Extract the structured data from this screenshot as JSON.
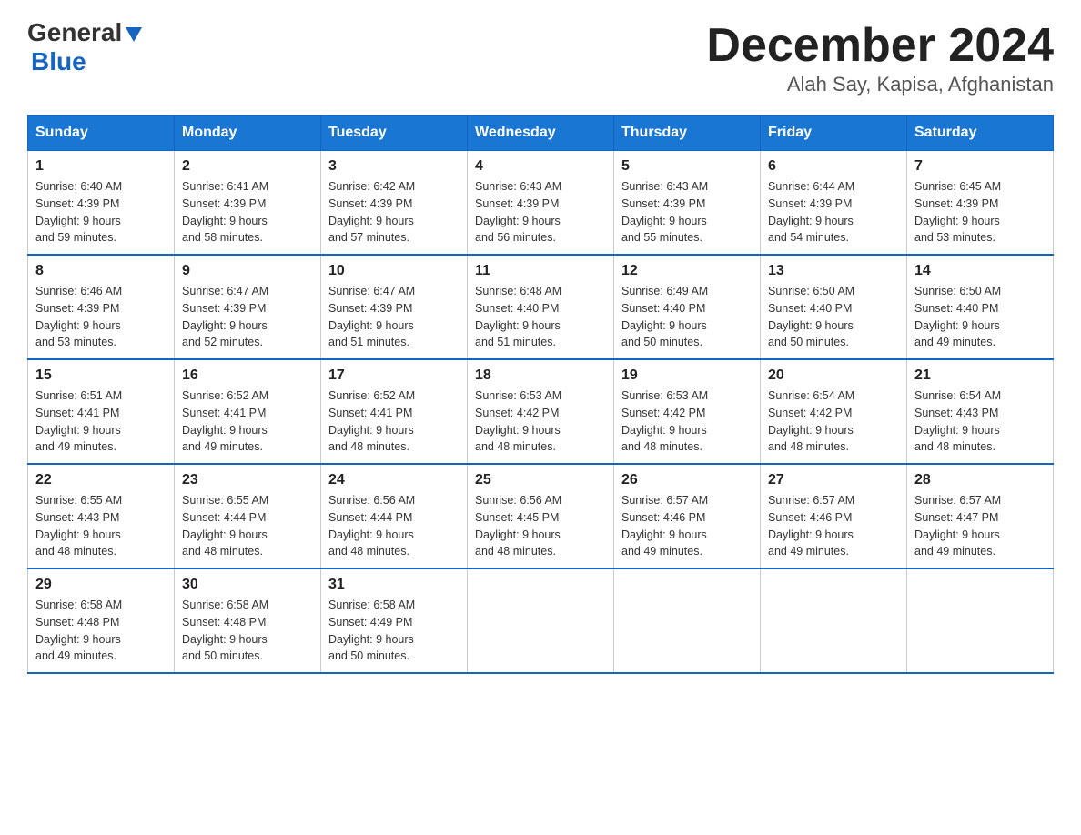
{
  "header": {
    "logo_general": "General",
    "logo_blue": "Blue",
    "title": "December 2024",
    "subtitle": "Alah Say, Kapisa, Afghanistan"
  },
  "weekdays": [
    "Sunday",
    "Monday",
    "Tuesday",
    "Wednesday",
    "Thursday",
    "Friday",
    "Saturday"
  ],
  "weeks": [
    [
      {
        "day": "1",
        "sunrise": "Sunrise: 6:40 AM",
        "sunset": "Sunset: 4:39 PM",
        "daylight": "Daylight: 9 hours",
        "daylight2": "and 59 minutes."
      },
      {
        "day": "2",
        "sunrise": "Sunrise: 6:41 AM",
        "sunset": "Sunset: 4:39 PM",
        "daylight": "Daylight: 9 hours",
        "daylight2": "and 58 minutes."
      },
      {
        "day": "3",
        "sunrise": "Sunrise: 6:42 AM",
        "sunset": "Sunset: 4:39 PM",
        "daylight": "Daylight: 9 hours",
        "daylight2": "and 57 minutes."
      },
      {
        "day": "4",
        "sunrise": "Sunrise: 6:43 AM",
        "sunset": "Sunset: 4:39 PM",
        "daylight": "Daylight: 9 hours",
        "daylight2": "and 56 minutes."
      },
      {
        "day": "5",
        "sunrise": "Sunrise: 6:43 AM",
        "sunset": "Sunset: 4:39 PM",
        "daylight": "Daylight: 9 hours",
        "daylight2": "and 55 minutes."
      },
      {
        "day": "6",
        "sunrise": "Sunrise: 6:44 AM",
        "sunset": "Sunset: 4:39 PM",
        "daylight": "Daylight: 9 hours",
        "daylight2": "and 54 minutes."
      },
      {
        "day": "7",
        "sunrise": "Sunrise: 6:45 AM",
        "sunset": "Sunset: 4:39 PM",
        "daylight": "Daylight: 9 hours",
        "daylight2": "and 53 minutes."
      }
    ],
    [
      {
        "day": "8",
        "sunrise": "Sunrise: 6:46 AM",
        "sunset": "Sunset: 4:39 PM",
        "daylight": "Daylight: 9 hours",
        "daylight2": "and 53 minutes."
      },
      {
        "day": "9",
        "sunrise": "Sunrise: 6:47 AM",
        "sunset": "Sunset: 4:39 PM",
        "daylight": "Daylight: 9 hours",
        "daylight2": "and 52 minutes."
      },
      {
        "day": "10",
        "sunrise": "Sunrise: 6:47 AM",
        "sunset": "Sunset: 4:39 PM",
        "daylight": "Daylight: 9 hours",
        "daylight2": "and 51 minutes."
      },
      {
        "day": "11",
        "sunrise": "Sunrise: 6:48 AM",
        "sunset": "Sunset: 4:40 PM",
        "daylight": "Daylight: 9 hours",
        "daylight2": "and 51 minutes."
      },
      {
        "day": "12",
        "sunrise": "Sunrise: 6:49 AM",
        "sunset": "Sunset: 4:40 PM",
        "daylight": "Daylight: 9 hours",
        "daylight2": "and 50 minutes."
      },
      {
        "day": "13",
        "sunrise": "Sunrise: 6:50 AM",
        "sunset": "Sunset: 4:40 PM",
        "daylight": "Daylight: 9 hours",
        "daylight2": "and 50 minutes."
      },
      {
        "day": "14",
        "sunrise": "Sunrise: 6:50 AM",
        "sunset": "Sunset: 4:40 PM",
        "daylight": "Daylight: 9 hours",
        "daylight2": "and 49 minutes."
      }
    ],
    [
      {
        "day": "15",
        "sunrise": "Sunrise: 6:51 AM",
        "sunset": "Sunset: 4:41 PM",
        "daylight": "Daylight: 9 hours",
        "daylight2": "and 49 minutes."
      },
      {
        "day": "16",
        "sunrise": "Sunrise: 6:52 AM",
        "sunset": "Sunset: 4:41 PM",
        "daylight": "Daylight: 9 hours",
        "daylight2": "and 49 minutes."
      },
      {
        "day": "17",
        "sunrise": "Sunrise: 6:52 AM",
        "sunset": "Sunset: 4:41 PM",
        "daylight": "Daylight: 9 hours",
        "daylight2": "and 48 minutes."
      },
      {
        "day": "18",
        "sunrise": "Sunrise: 6:53 AM",
        "sunset": "Sunset: 4:42 PM",
        "daylight": "Daylight: 9 hours",
        "daylight2": "and 48 minutes."
      },
      {
        "day": "19",
        "sunrise": "Sunrise: 6:53 AM",
        "sunset": "Sunset: 4:42 PM",
        "daylight": "Daylight: 9 hours",
        "daylight2": "and 48 minutes."
      },
      {
        "day": "20",
        "sunrise": "Sunrise: 6:54 AM",
        "sunset": "Sunset: 4:42 PM",
        "daylight": "Daylight: 9 hours",
        "daylight2": "and 48 minutes."
      },
      {
        "day": "21",
        "sunrise": "Sunrise: 6:54 AM",
        "sunset": "Sunset: 4:43 PM",
        "daylight": "Daylight: 9 hours",
        "daylight2": "and 48 minutes."
      }
    ],
    [
      {
        "day": "22",
        "sunrise": "Sunrise: 6:55 AM",
        "sunset": "Sunset: 4:43 PM",
        "daylight": "Daylight: 9 hours",
        "daylight2": "and 48 minutes."
      },
      {
        "day": "23",
        "sunrise": "Sunrise: 6:55 AM",
        "sunset": "Sunset: 4:44 PM",
        "daylight": "Daylight: 9 hours",
        "daylight2": "and 48 minutes."
      },
      {
        "day": "24",
        "sunrise": "Sunrise: 6:56 AM",
        "sunset": "Sunset: 4:44 PM",
        "daylight": "Daylight: 9 hours",
        "daylight2": "and 48 minutes."
      },
      {
        "day": "25",
        "sunrise": "Sunrise: 6:56 AM",
        "sunset": "Sunset: 4:45 PM",
        "daylight": "Daylight: 9 hours",
        "daylight2": "and 48 minutes."
      },
      {
        "day": "26",
        "sunrise": "Sunrise: 6:57 AM",
        "sunset": "Sunset: 4:46 PM",
        "daylight": "Daylight: 9 hours",
        "daylight2": "and 49 minutes."
      },
      {
        "day": "27",
        "sunrise": "Sunrise: 6:57 AM",
        "sunset": "Sunset: 4:46 PM",
        "daylight": "Daylight: 9 hours",
        "daylight2": "and 49 minutes."
      },
      {
        "day": "28",
        "sunrise": "Sunrise: 6:57 AM",
        "sunset": "Sunset: 4:47 PM",
        "daylight": "Daylight: 9 hours",
        "daylight2": "and 49 minutes."
      }
    ],
    [
      {
        "day": "29",
        "sunrise": "Sunrise: 6:58 AM",
        "sunset": "Sunset: 4:48 PM",
        "daylight": "Daylight: 9 hours",
        "daylight2": "and 49 minutes."
      },
      {
        "day": "30",
        "sunrise": "Sunrise: 6:58 AM",
        "sunset": "Sunset: 4:48 PM",
        "daylight": "Daylight: 9 hours",
        "daylight2": "and 50 minutes."
      },
      {
        "day": "31",
        "sunrise": "Sunrise: 6:58 AM",
        "sunset": "Sunset: 4:49 PM",
        "daylight": "Daylight: 9 hours",
        "daylight2": "and 50 minutes."
      },
      null,
      null,
      null,
      null
    ]
  ]
}
